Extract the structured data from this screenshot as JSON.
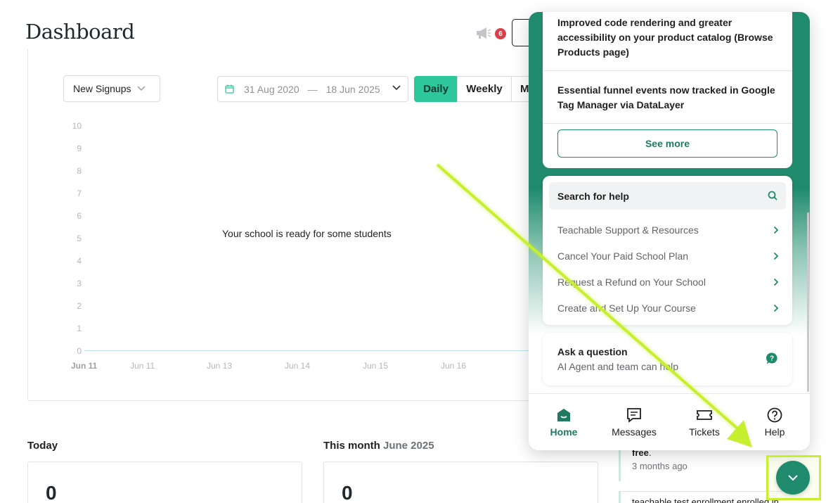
{
  "header": {
    "title": "Dashboard",
    "announcements_count": "6"
  },
  "chart": {
    "metric_select": "New Signups",
    "date_start": "31 Aug 2020",
    "date_separator": "—",
    "date_end": "18 Jun 2025",
    "granularity": [
      "Daily",
      "Weekly",
      "M"
    ],
    "active_granularity": "Daily",
    "empty_message": "Your school is ready for some students",
    "y_ticks": [
      "10",
      "9",
      "8",
      "7",
      "6",
      "5",
      "4",
      "3",
      "2",
      "1",
      "0"
    ],
    "x_ticks": [
      "Jun 11",
      "Jun 11",
      "Jun 13",
      "Jun 14",
      "Jun 15",
      "Jun 16"
    ]
  },
  "stats": {
    "today_label": "Today",
    "today_value": "0",
    "month_label": "This month",
    "month_sub": "June 2025",
    "month_value": "0"
  },
  "feed": {
    "item1_bold": "free",
    "item1_punct": ".",
    "item1_time": "3 months ago",
    "item2_text": "teachable test enrollment enrolled in"
  },
  "widget": {
    "news": [
      "Improved code rendering and greater accessibility on your product catalog (Browse Products page)",
      "Essential funnel events now tracked in Google Tag Manager via DataLayer"
    ],
    "see_more": "See more",
    "search_placeholder": "Search for help",
    "articles": [
      "Teachable Support & Resources",
      "Cancel Your Paid School Plan",
      "Request a Refund on Your School",
      "Create and Set Up Your Course"
    ],
    "ask_title": "Ask a question",
    "ask_subtitle": "AI Agent and team can help",
    "nav": [
      "Home",
      "Messages",
      "Tickets",
      "Help"
    ],
    "active_nav": "Home"
  },
  "colors": {
    "brand_green": "#1f8a6c",
    "accent_green": "#2cc79a",
    "badge_red": "#d9414a",
    "annotation": "#c6f02e"
  }
}
